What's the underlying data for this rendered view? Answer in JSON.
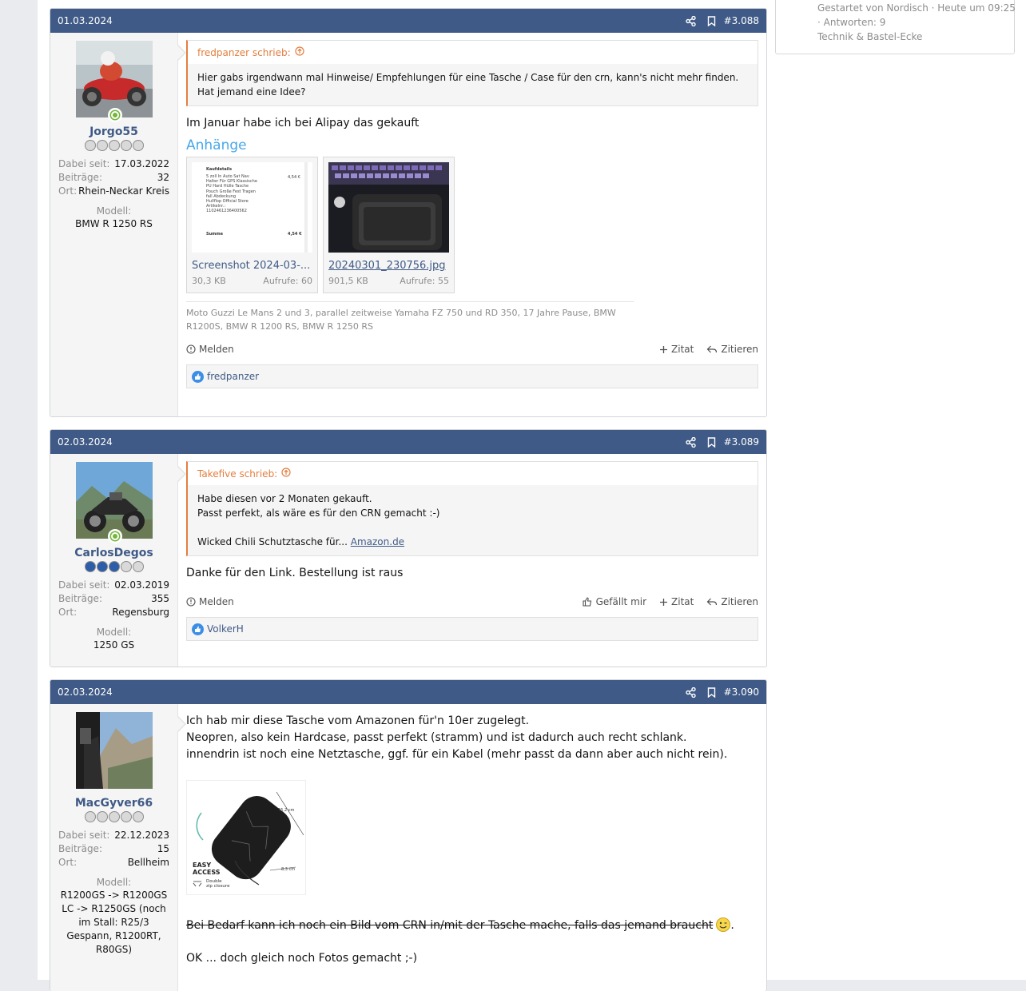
{
  "sidebar_card": {
    "line1": "Gestartet von Nordisch · Heute um 09:25",
    "line2": "· Antworten: 9",
    "line3": "Technik & Bastel-Ecke"
  },
  "posts": [
    {
      "date": "01.03.2024",
      "number": "#3.088",
      "user": {
        "name": "Jorgo55",
        "stars_filled": 0,
        "joined_label": "Dabei seit:",
        "joined": "17.03.2022",
        "posts_label": "Beiträge:",
        "posts": "32",
        "location_label": "Ort:",
        "location": "Rhein-Neckar Kreis",
        "model_label": "Modell:",
        "model": "BMW R 1250 RS"
      },
      "quote": {
        "author": "fredpanzer schrieb:",
        "text": "Hier gabs irgendwann mal Hinweise/ Empfehlungen für eine Tasche / Case für den crn, kann's nicht mehr finden. Hat jemand eine Idee?"
      },
      "message": "Im Januar habe ich bei Alipay das gekauft",
      "attachments_title": "Anhänge",
      "attachments": [
        {
          "name": "Screenshot 2024-03-...",
          "size": "30,3 KB",
          "views": "Aufrufe: 60"
        },
        {
          "name": "20240301_230756.jpg",
          "size": "901,5 KB",
          "views": "Aufrufe: 55"
        }
      ],
      "receipt": {
        "title": "Kaufdetails",
        "lines": [
          "5 zoll In Auto Sat Nav",
          "Halter Für GPS Klassische",
          "PU Hard Hülle Tasche",
          "Pouch Große Fest Tragen",
          "fall Abdeckung",
          "Hullflop Official Store",
          "Artikelnr.:",
          "1102461236400562"
        ],
        "price": "4,54 €",
        "sum_label": "Summe",
        "sum": "4,54 €"
      },
      "signature": "Moto Guzzi Le Mans 2 und 3, parallel zeitweise Yamaha FZ 750 und RD 350, 17 Jahre Pause, BMW R1200S, BMW R 1200 RS, BMW R 1250 RS",
      "actions": {
        "report": "Melden",
        "quote": "Zitat",
        "reply": "Zitieren"
      },
      "likes": "fredpanzer"
    },
    {
      "date": "02.03.2024",
      "number": "#3.089",
      "user": {
        "name": "CarlosDegos",
        "stars_filled": 3,
        "joined_label": "Dabei seit:",
        "joined": "02.03.2019",
        "posts_label": "Beiträge:",
        "posts": "355",
        "location_label": "Ort:",
        "location": "Regensburg",
        "model_label": "Modell:",
        "model": "1250 GS"
      },
      "quote": {
        "author": "Takefive schrieb:",
        "line1": "Habe diesen vor 2 Monaten gekauft.",
        "line2": "Passt perfekt, als wäre es für den CRN gemacht :-)",
        "line3": "Wicked Chili Schutztasche für...",
        "link": "Amazon.de"
      },
      "message": "Danke für den Link. Bestellung ist raus",
      "actions": {
        "report": "Melden",
        "like": "Gefällt mir",
        "quote": "Zitat",
        "reply": "Zitieren"
      },
      "likes": "VolkerH"
    },
    {
      "date": "02.03.2024",
      "number": "#3.090",
      "user": {
        "name": "MacGyver66",
        "stars_filled": 0,
        "joined_label": "Dabei seit:",
        "joined": "22.12.2023",
        "posts_label": "Beiträge:",
        "posts": "15",
        "location_label": "Ort:",
        "location": "Bellheim",
        "model_label": "Modell:",
        "model": "R1200GS -> R1200GS LC -> R1250GS (noch im Stall: R25/3 Gespann, R1200RT, R80GS)"
      },
      "message_line1": "Ich hab mir diese Tasche vom Amazonen für'n 10er zugelegt.",
      "message_line2": "Neopren, also kein Hardcase, passt perfekt (stramm) und ist dadurch auch recht schlank.",
      "message_line3": "innendrin ist noch eine Netztasche, ggf. für ein Kabel (mehr passt da dann aber auch nicht rein).",
      "image_labels": {
        "dim1": "15,2 cm",
        "dim2": "8,3 cm",
        "easy": "EASY",
        "access": "ACCESS",
        "double": "Double",
        "zip": "zip closure"
      },
      "strike_text": "Bei Bedarf kann ich noch ein Bild vom CRN in/mit der Tasche mache, falls das jemand braucht",
      "after_strike": ".",
      "last_line": "OK ... doch gleich noch Fotos gemacht ;-)"
    }
  ],
  "colors": {
    "header": "#3f5a86",
    "quote_accent": "#e37e3f",
    "link": "#47a7eb",
    "online": "#74b63c"
  }
}
